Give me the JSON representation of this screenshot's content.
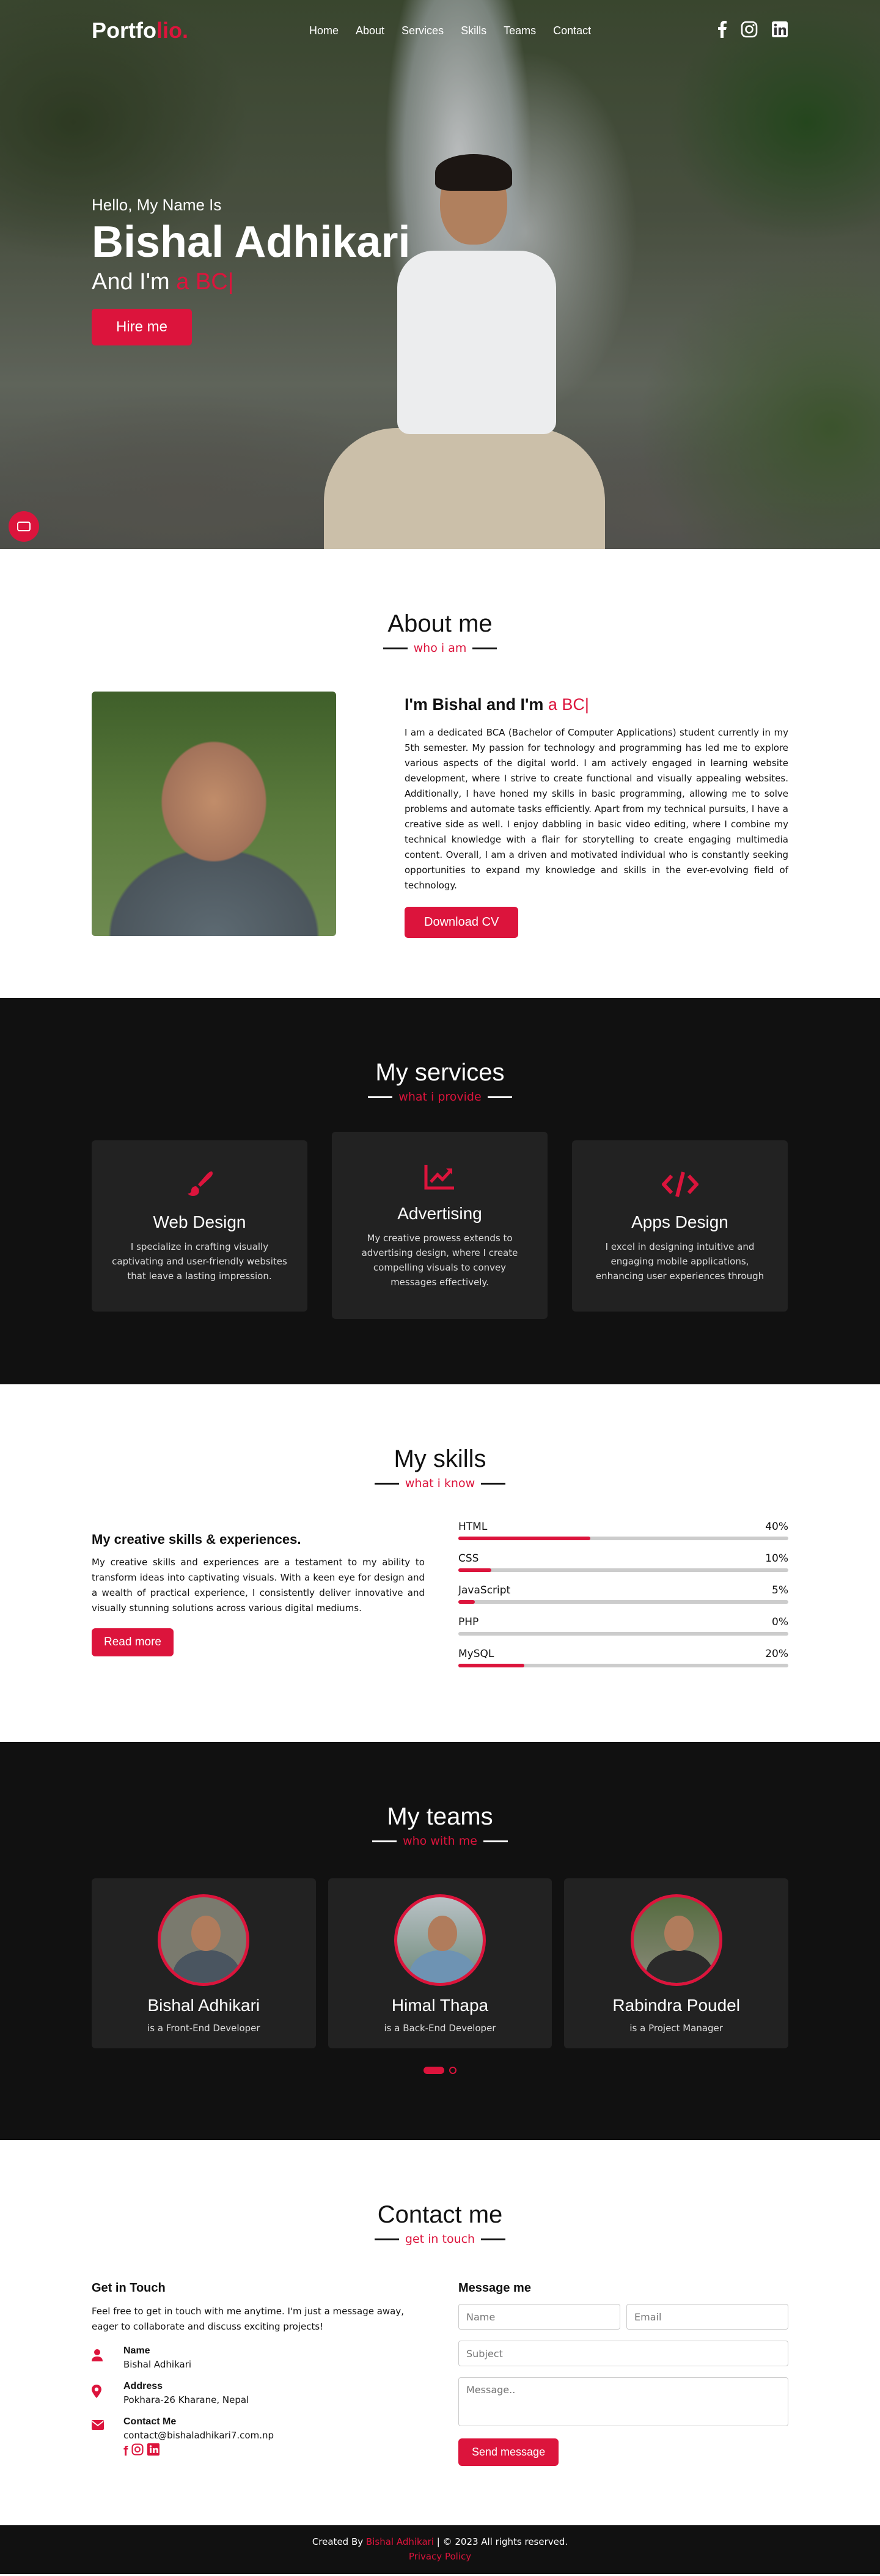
{
  "nav": {
    "logo_main": "Portfo",
    "logo_accent": "lio.",
    "links": [
      "Home",
      "About",
      "Services",
      "Skills",
      "Teams",
      "Contact"
    ],
    "social_icons": [
      "facebook-icon",
      "instagram-icon",
      "linkedin-icon"
    ]
  },
  "hero": {
    "greeting": "Hello, My Name Is",
    "name": "Bishal Adhikari",
    "role_prefix": "And I'm",
    "role_typed": "a BC|",
    "button": "Hire me"
  },
  "about": {
    "title": "About me",
    "subtitle": "who i am",
    "heading_prefix": "I'm Bishal and I'm",
    "heading_typed": "a BC|",
    "paragraph": "I am a dedicated BCA (Bachelor of Computer Applications) student currently in my 5th semester. My passion for technology and programming has led me to explore various aspects of the digital world. I am actively engaged in learning website development, where I strive to create functional and visually appealing websites. Additionally, I have honed my skills in basic programming, allowing me to solve problems and automate tasks efficiently. Apart from my technical pursuits, I have a creative side as well. I enjoy dabbling in basic video editing, where I combine my technical knowledge with a flair for storytelling to create engaging multimedia content. Overall, I am a driven and motivated individual who is constantly seeking opportunities to expand my knowledge and skills in the ever-evolving field of technology.",
    "button": "Download CV"
  },
  "services": {
    "title": "My services",
    "subtitle": "what i provide",
    "cards": [
      {
        "icon": "paint-brush-icon",
        "title": "Web Design",
        "text": "I specialize in crafting visually captivating and user-friendly websites that leave a lasting impression."
      },
      {
        "icon": "chart-line-icon",
        "title": "Advertising",
        "text": "My creative prowess extends to advertising design, where I create compelling visuals to convey messages effectively."
      },
      {
        "icon": "code-icon",
        "title": "Apps Design",
        "text": "I excel in designing intuitive and engaging mobile applications, enhancing user experiences through"
      }
    ]
  },
  "skills": {
    "title": "My skills",
    "subtitle": "what i know",
    "heading": "My creative skills & experiences.",
    "paragraph": "My creative skills and experiences are a testament to my ability to transform ideas into captivating visuals. With a keen eye for design and a wealth of practical experience, I consistently deliver innovative and visually stunning solutions across various digital mediums.",
    "button": "Read more",
    "bars": [
      {
        "name": "HTML",
        "percent": "40%",
        "value": 40
      },
      {
        "name": "CSS",
        "percent": "10%",
        "value": 10
      },
      {
        "name": "JavaScript",
        "percent": "5%",
        "value": 5
      },
      {
        "name": "PHP",
        "percent": "0%",
        "value": 0
      },
      {
        "name": "MySQL",
        "percent": "20%",
        "value": 20
      }
    ]
  },
  "teams": {
    "title": "My teams",
    "subtitle": "who with me",
    "members": [
      {
        "name": "Bishal Adhikari",
        "role": "is a Front-End Developer"
      },
      {
        "name": "Himal Thapa",
        "role": "is a Back-End Developer"
      },
      {
        "name": "Rabindra Poudel",
        "role": "is a Project Manager"
      }
    ]
  },
  "contact": {
    "title": "Contact me",
    "subtitle": "get in touch",
    "left_heading": "Get in Touch",
    "intro": "Feel free to get in touch with me anytime. I'm just a message away, eager to collaborate and discuss exciting projects!",
    "name_label": "Name",
    "name_value": "Bishal Adhikari",
    "address_label": "Address",
    "address_value": "Pokhara-26 Kharane, Nepal",
    "contact_label": "Contact Me",
    "contact_value": "contact@bishaladhikari7.com.np",
    "right_heading": "Message me",
    "placeholder_name": "Name",
    "placeholder_email": "Email",
    "placeholder_subject": "Subject",
    "placeholder_message": "Message..",
    "button": "Send message"
  },
  "footer": {
    "prefix": "Created By",
    "name": "Bishal Adhikari",
    "suffix": "| © 2023 All rights reserved.",
    "privacy": "Privacy Policy"
  },
  "colors": {
    "accent": "#dc143c",
    "dark": "#111111",
    "card": "#222222"
  }
}
